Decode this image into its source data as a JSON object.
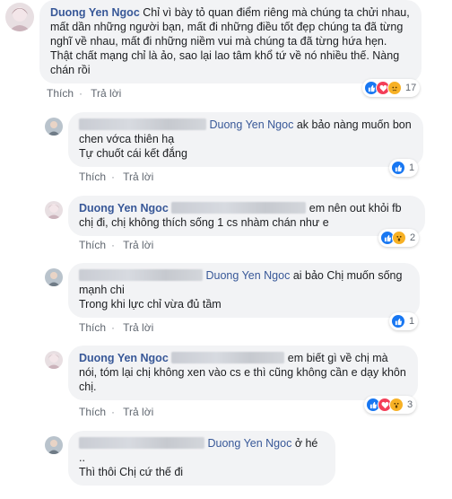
{
  "colors": {
    "author": "#385898",
    "bubble": "#f2f3f5",
    "meta": "#606770",
    "like": "#1877f2",
    "love": "#f33e58",
    "sad": "#f7b125"
  },
  "comments": [
    {
      "author": "Duong Yen Ngoc",
      "text": "Chỉ vì bày tỏ quan điểm riêng mà chúng ta chửi nhau, mất dần những người bạn, mất đi những điều tốt đẹp chúng ta đã từng nghĩ về nhau, mất đi những niềm vui mà chúng ta đã từng hứa hẹn. Thật chất mạng chỉ là ảo, sao lại lao tâm khổ tứ về nó nhiều thế. Nàng chán rồi",
      "like": "Thích",
      "reply": "Trả lời",
      "reactions": [
        "like-icon",
        "love-icon",
        "sad-icon"
      ],
      "reaction_count": "17"
    },
    {
      "mention": "Duong Yen Ngoc",
      "text": "ak bảo nàng muốn bon chen vớca thiên hạ\nTự chuốt cái kết đắng",
      "like": "Thích",
      "reply": "Trả lời",
      "reactions": [
        "like-icon"
      ],
      "reaction_count": "1"
    },
    {
      "author": "Duong Yen Ngoc",
      "text": "em nên out khỏi fb chị đi, chị không thích sống 1 cs nhàm chán như e",
      "like": "Thích",
      "reply": "Trả lời",
      "reactions": [
        "like-icon",
        "wow-icon"
      ],
      "reaction_count": "2"
    },
    {
      "mention": "Duong Yen Ngoc",
      "text": "ai bảo Chị muốn sống mạnh chi\nTrong khi lực chỉ vừa đủ tầm",
      "like": "Thích",
      "reply": "Trả lời",
      "reactions": [
        "like-icon"
      ],
      "reaction_count": "1"
    },
    {
      "author": "Duong Yen Ngoc",
      "text": "em biết gì về chị mà nói, tóm lại chị không xen vào cs e thì cũng không cần e dạy khôn chị.",
      "like": "Thích",
      "reply": "Trả lời",
      "reactions": [
        "like-icon",
        "love-icon",
        "wow-icon"
      ],
      "reaction_count": "3"
    },
    {
      "mention": "Duong Yen Ngoc",
      "text_inline": "ở hé ..",
      "text": "Thì thôi Chị cứ thế đi"
    }
  ]
}
